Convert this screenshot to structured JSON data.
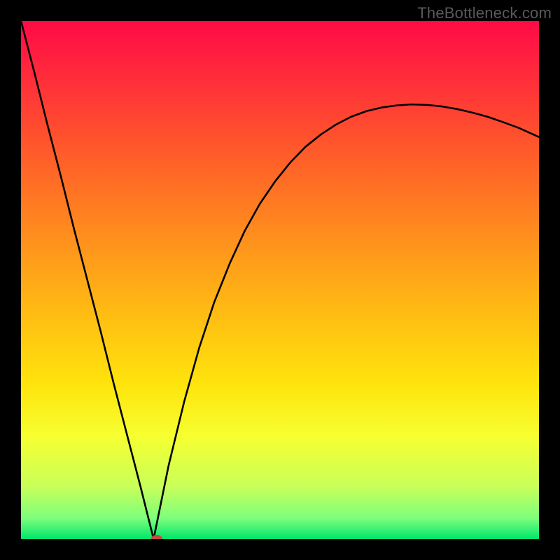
{
  "watermark": "TheBottleneck.com",
  "chart_data": {
    "type": "line",
    "title": "",
    "xlabel": "",
    "ylabel": "",
    "xlim": [
      0,
      100
    ],
    "ylim": [
      0,
      100
    ],
    "grid": false,
    "legend": false,
    "gradient_stops": [
      {
        "pos": 0.0,
        "color": "#ff0b46"
      },
      {
        "pos": 0.1,
        "color": "#ff2a3c"
      },
      {
        "pos": 0.25,
        "color": "#ff5a2a"
      },
      {
        "pos": 0.4,
        "color": "#ff8a1f"
      },
      {
        "pos": 0.55,
        "color": "#ffb814"
      },
      {
        "pos": 0.7,
        "color": "#ffe40c"
      },
      {
        "pos": 0.8,
        "color": "#f7ff30"
      },
      {
        "pos": 0.9,
        "color": "#c8ff5a"
      },
      {
        "pos": 0.96,
        "color": "#7dff7d"
      },
      {
        "pos": 1.0,
        "color": "#00e66a"
      }
    ],
    "series": [
      {
        "name": "bottleneck-curve",
        "color": "#000000",
        "x": [
          0.0,
          2.6,
          5.1,
          7.7,
          10.2,
          12.8,
          15.4,
          17.9,
          20.5,
          23.1,
          25.6,
          25.6,
          28.5,
          31.5,
          34.4,
          37.3,
          40.3,
          43.2,
          46.1,
          49.1,
          52.0,
          54.9,
          57.9,
          60.8,
          63.7,
          66.7,
          69.6,
          72.5,
          75.4,
          78.4,
          81.3,
          84.2,
          87.2,
          90.1,
          93.0,
          96.0,
          98.9,
          100.0
        ],
        "y": [
          100.0,
          90.0,
          80.0,
          70.0,
          60.0,
          50.0,
          40.0,
          30.0,
          20.0,
          10.0,
          0.0,
          0.0,
          14.2,
          26.5,
          36.9,
          45.7,
          53.2,
          59.5,
          64.7,
          69.1,
          72.7,
          75.7,
          78.1,
          80.0,
          81.5,
          82.6,
          83.3,
          83.7,
          83.9,
          83.8,
          83.5,
          83.0,
          82.3,
          81.5,
          80.5,
          79.4,
          78.1,
          77.6
        ]
      }
    ],
    "marker": {
      "name": "optimal-point",
      "x": 26.2,
      "y": 0.0,
      "rx": 1.1,
      "ry": 0.8,
      "color": "#c44a3f"
    }
  }
}
